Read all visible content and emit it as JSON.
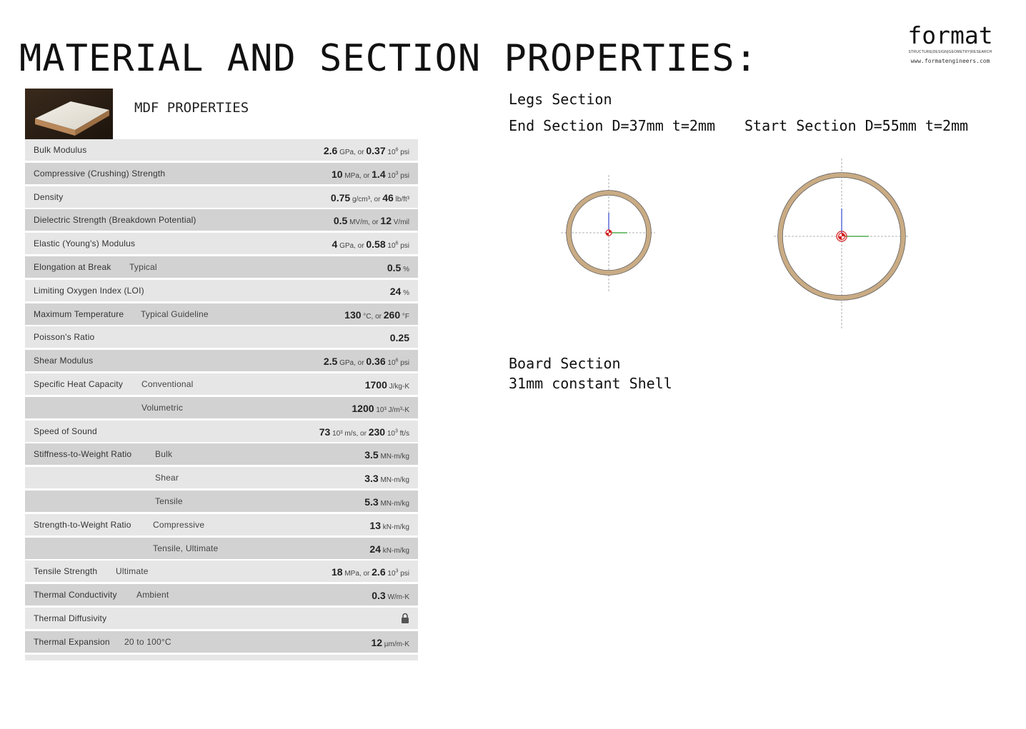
{
  "title": "MATERIAL AND SECTION PROPERTIES:",
  "logo": {
    "word": "format",
    "tagline": "STRUCTURE|DESIGN|GEOMETRY|RESEARCH",
    "url": "www.formatengineers.com"
  },
  "material": {
    "heading": "MDF PROPERTIES",
    "photo_icon": "mdf-board-photo",
    "rows": [
      {
        "name": "Bulk Modulus",
        "condition": "",
        "v1": "2.6",
        "u1": "GPa, or",
        "v2": "0.37",
        "u2pre": "10",
        "u2sup": "6",
        "u2": "psi"
      },
      {
        "name": "Compressive (Crushing) Strength",
        "condition": "",
        "v1": "10",
        "u1": "MPa, or",
        "v2": "1.4",
        "u2pre": "10",
        "u2sup": "3",
        "u2": "psi"
      },
      {
        "name": "Density",
        "condition": "",
        "v1": "0.75",
        "u1": "g/cm³, or",
        "v2": "46",
        "u2pre": "",
        "u2sup": "",
        "u2": "lb/ft³"
      },
      {
        "name": "Dielectric Strength (Breakdown Potential)",
        "condition": "",
        "v1": "0.5",
        "u1": "MV/m, or",
        "v2": "12",
        "u2pre": "",
        "u2sup": "",
        "u2": "V/mil"
      },
      {
        "name": "Elastic (Young's) Modulus",
        "condition": "",
        "v1": "4",
        "u1": "GPa, or",
        "v2": "0.58",
        "u2pre": "10",
        "u2sup": "6",
        "u2": "psi"
      },
      {
        "name": "Elongation at Break",
        "condition": "Typical",
        "v1": "0.5",
        "u1": "%",
        "v2": "",
        "u2pre": "",
        "u2sup": "",
        "u2": ""
      },
      {
        "name": "Limiting Oxygen Index (LOI)",
        "condition": "",
        "v1": "24",
        "u1": "%",
        "v2": "",
        "u2pre": "",
        "u2sup": "",
        "u2": ""
      },
      {
        "name": "Maximum Temperature",
        "condition": "Typical Guideline",
        "v1": "130",
        "u1": "°C, or",
        "v2": "260",
        "u2pre": "",
        "u2sup": "",
        "u2": "°F"
      },
      {
        "name": "Poisson's Ratio",
        "condition": "",
        "v1": "0.25",
        "u1": "",
        "v2": "",
        "u2pre": "",
        "u2sup": "",
        "u2": ""
      },
      {
        "name": "Shear Modulus",
        "condition": "",
        "v1": "2.5",
        "u1": "GPa, or",
        "v2": "0.36",
        "u2pre": "10",
        "u2sup": "6",
        "u2": "psi"
      },
      {
        "name": "Specific Heat Capacity",
        "condition": "Conventional",
        "v1": "1700",
        "u1": "J/kg-K",
        "v2": "",
        "u2pre": "",
        "u2sup": "",
        "u2": ""
      },
      {
        "name": "",
        "condition": "Volumetric",
        "v1": "1200",
        "u1": "10³ J/m³-K",
        "v2": "",
        "u2pre": "",
        "u2sup": "",
        "u2": ""
      },
      {
        "name": "Speed of Sound",
        "condition": "",
        "v1": "73",
        "u1": "10³ m/s, or",
        "v2": "230",
        "u2pre": "10",
        "u2sup": "3",
        "u2": "ft/s"
      },
      {
        "name": "Stiffness-to-Weight Ratio",
        "condition": "Bulk",
        "v1": "3.5",
        "u1": "MN-m/kg",
        "v2": "",
        "u2pre": "",
        "u2sup": "",
        "u2": ""
      },
      {
        "name": "",
        "condition": "Shear",
        "v1": "3.3",
        "u1": "MN-m/kg",
        "v2": "",
        "u2pre": "",
        "u2sup": "",
        "u2": ""
      },
      {
        "name": "",
        "condition": "Tensile",
        "v1": "5.3",
        "u1": "MN-m/kg",
        "v2": "",
        "u2pre": "",
        "u2sup": "",
        "u2": ""
      },
      {
        "name": "Strength-to-Weight Ratio",
        "condition": "Compressive",
        "v1": "13",
        "u1": "kN-m/kg",
        "v2": "",
        "u2pre": "",
        "u2sup": "",
        "u2": ""
      },
      {
        "name": "",
        "condition": "Tensile, Ultimate",
        "v1": "24",
        "u1": "kN-m/kg",
        "v2": "",
        "u2pre": "",
        "u2sup": "",
        "u2": ""
      },
      {
        "name": "Tensile Strength",
        "condition": "Ultimate",
        "v1": "18",
        "u1": "MPa, or",
        "v2": "2.6",
        "u2pre": "10",
        "u2sup": "3",
        "u2": "psi"
      },
      {
        "name": "Thermal Conductivity",
        "condition": "Ambient",
        "v1": "0.3",
        "u1": "W/m-K",
        "v2": "",
        "u2pre": "",
        "u2sup": "",
        "u2": ""
      },
      {
        "name": "Thermal Diffusivity",
        "condition": "",
        "v1": "",
        "u1": "",
        "v2": "",
        "u2pre": "",
        "u2sup": "",
        "u2": "",
        "locked": true
      },
      {
        "name": "Thermal Expansion",
        "condition": "20 to 100°C",
        "v1": "12",
        "u1": "µm/m-K",
        "v2": "",
        "u2pre": "",
        "u2sup": "",
        "u2": ""
      }
    ]
  },
  "sections": {
    "legs_title": "Legs Section",
    "end_title": "End Section D=37mm t=2mm",
    "start_title": "Start Section D=55mm t=2mm",
    "board_title": "Board Section",
    "board_sub": "31mm constant Shell",
    "ring_color": "#c9ab84",
    "ring_edge_color": "#5a5a5a"
  }
}
